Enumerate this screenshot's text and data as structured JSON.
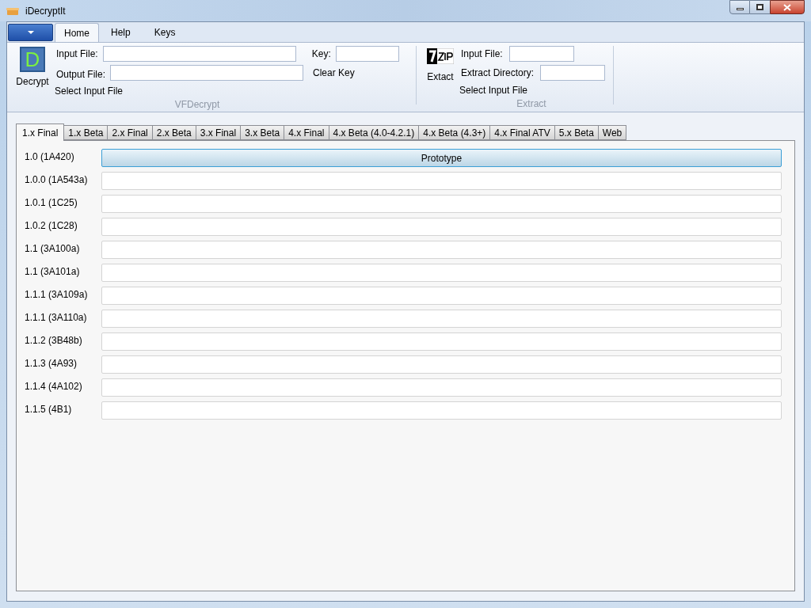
{
  "window": {
    "title": "iDecryptIt"
  },
  "ribbon_tabs": [
    {
      "label": "Home",
      "selected": true
    },
    {
      "label": "Help",
      "selected": false
    },
    {
      "label": "Keys",
      "selected": false
    }
  ],
  "vfdecrypt": {
    "icon_letter": "D",
    "button": "Decrypt",
    "input_label": "Input File:",
    "output_label": "Output File:",
    "key_label": "Key:",
    "clear_key": "Clear Key",
    "select_input": "Select Input File",
    "group_label": "VFDecrypt"
  },
  "extract": {
    "button": "Extact",
    "input_label": "Input File:",
    "dir_label": "Extract Directory:",
    "select_input": "Select Input File",
    "group_label": "Extract"
  },
  "version_tabs": [
    {
      "label": "1.x Final",
      "selected": true
    },
    {
      "label": "1.x Beta",
      "selected": false
    },
    {
      "label": "2.x Final",
      "selected": false
    },
    {
      "label": "2.x Beta",
      "selected": false
    },
    {
      "label": "3.x Final",
      "selected": false
    },
    {
      "label": "3.x Beta",
      "selected": false
    },
    {
      "label": "4.x Final",
      "selected": false
    },
    {
      "label": "4.x Beta (4.0-4.2.1)",
      "selected": false
    },
    {
      "label": "4.x Beta (4.3+)",
      "selected": false
    },
    {
      "label": "4.x Final ATV",
      "selected": false
    },
    {
      "label": "5.x Beta",
      "selected": false
    },
    {
      "label": "Web",
      "selected": false
    }
  ],
  "rows": [
    {
      "label": "1.0 (1A420)",
      "button": "Prototype",
      "highlighted": true
    },
    {
      "label": "1.0.0 (1A543a)",
      "highlighted": false
    },
    {
      "label": "1.0.1 (1C25)",
      "highlighted": false
    },
    {
      "label": "1.0.2 (1C28)",
      "highlighted": false
    },
    {
      "label": "1.1 (3A100a)",
      "highlighted": false
    },
    {
      "label": "1.1 (3A101a)",
      "highlighted": false
    },
    {
      "label": "1.1.1 (3A109a)",
      "highlighted": false
    },
    {
      "label": "1.1.1 (3A110a)",
      "highlighted": false
    },
    {
      "label": "1.1.2 (3B48b)",
      "highlighted": false
    },
    {
      "label": "1.1.3 (4A93)",
      "highlighted": false
    },
    {
      "label": "1.1.4 (4A102)",
      "highlighted": false
    },
    {
      "label": "1.1.5 (4B1)",
      "highlighted": false
    }
  ]
}
